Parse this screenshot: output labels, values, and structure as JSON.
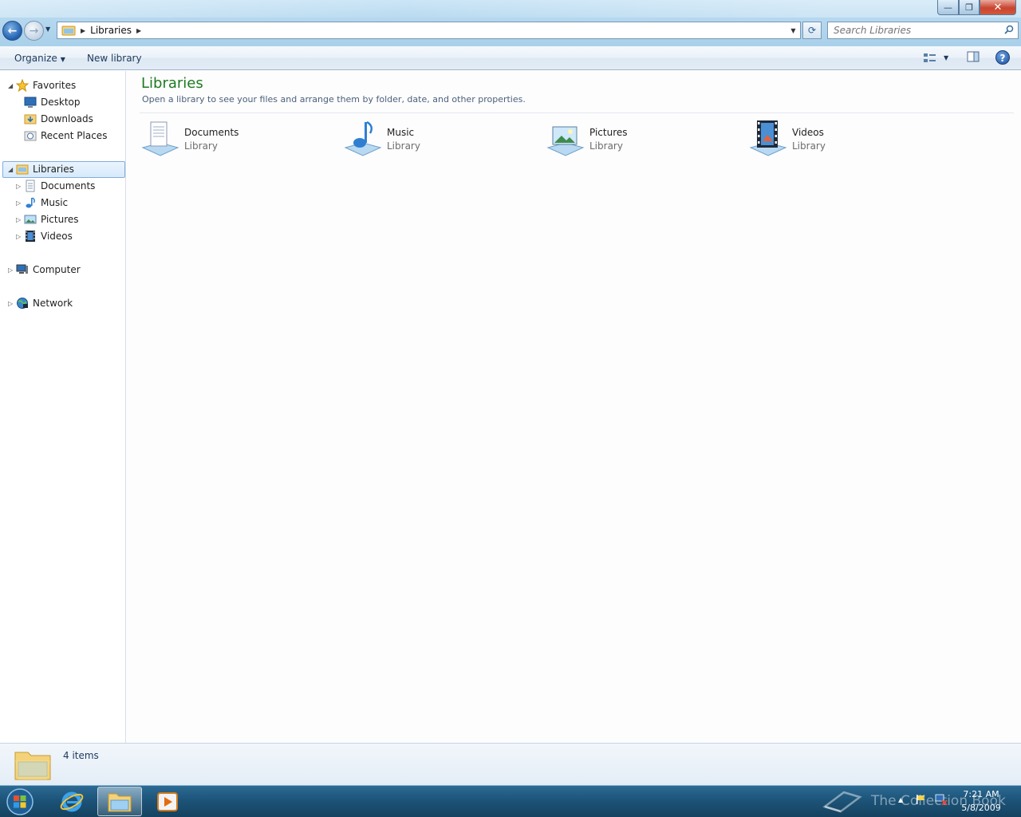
{
  "window": {
    "minimize_glyph": "—",
    "maximize_glyph": "❐",
    "close_glyph": "✕"
  },
  "address": {
    "crumb": "Libraries",
    "search_placeholder": "Search Libraries"
  },
  "toolbar": {
    "organize_label": "Organize",
    "new_library_label": "New library"
  },
  "navigation": {
    "favorites": {
      "label": "Favorites",
      "items": [
        {
          "label": "Desktop",
          "icon": "desktop-icon"
        },
        {
          "label": "Downloads",
          "icon": "downloads-folder-icon"
        },
        {
          "label": "Recent Places",
          "icon": "recent-places-icon"
        }
      ]
    },
    "libraries": {
      "label": "Libraries",
      "items": [
        {
          "label": "Documents",
          "icon": "documents-icon"
        },
        {
          "label": "Music",
          "icon": "music-icon"
        },
        {
          "label": "Pictures",
          "icon": "pictures-icon"
        },
        {
          "label": "Videos",
          "icon": "videos-icon"
        }
      ]
    },
    "computer_label": "Computer",
    "network_label": "Network"
  },
  "content": {
    "title": "Libraries",
    "description": "Open a library to see your files and arrange them by folder, date, and other properties.",
    "libraries": [
      {
        "name": "Documents",
        "type": "Library"
      },
      {
        "name": "Music",
        "type": "Library"
      },
      {
        "name": "Pictures",
        "type": "Library"
      },
      {
        "name": "Videos",
        "type": "Library"
      }
    ]
  },
  "details": {
    "item_count": "4 items"
  },
  "taskbar": {
    "watermark": "The Collection Book",
    "time": "7:21 AM",
    "date": "5/8/2009"
  },
  "colors": {
    "title_green": "#1e7a1e",
    "taskbar_blue": "#1d5479",
    "selection_border": "#84acdd"
  }
}
